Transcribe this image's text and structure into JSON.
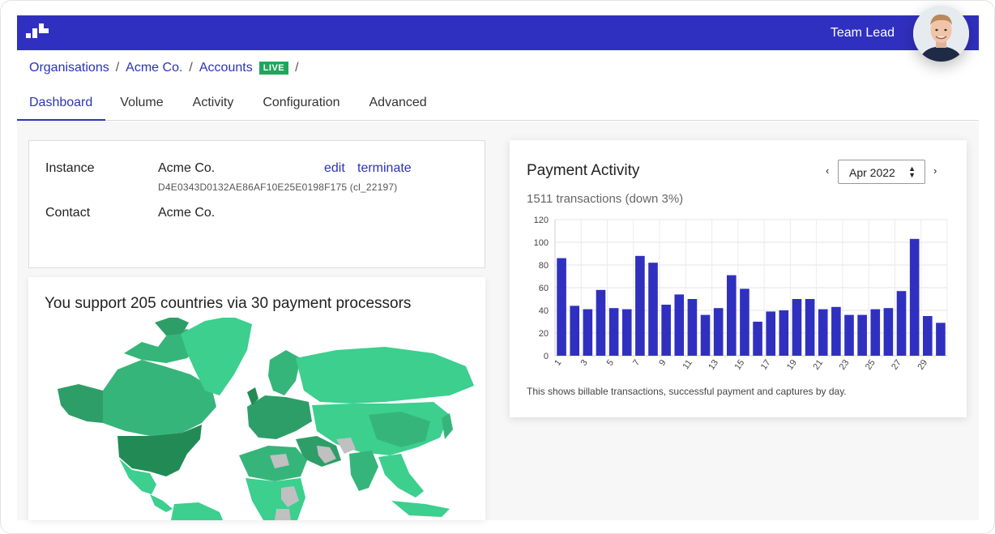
{
  "header": {
    "user_label": "Team Lead",
    "brand_color": "#3030c0"
  },
  "breadcrumb": {
    "items": [
      "Organisations",
      "Acme Co.",
      "Accounts"
    ],
    "separator": "/",
    "live_badge": "LIVE"
  },
  "tabs": [
    {
      "label": "Dashboard",
      "active": true
    },
    {
      "label": "Volume",
      "active": false
    },
    {
      "label": "Activity",
      "active": false
    },
    {
      "label": "Configuration",
      "active": false
    },
    {
      "label": "Advanced",
      "active": false
    }
  ],
  "instance_card": {
    "instance_label": "Instance",
    "instance_value": "Acme Co.",
    "instance_id": "D4E0343D0132AE86AF10E25E0198F175 (cl_22197)",
    "edit_label": "edit",
    "terminate_label": "terminate",
    "contact_label": "Contact",
    "contact_value": "Acme Co."
  },
  "map_card": {
    "title": "You support 205 countries via 30 payment processors"
  },
  "payment_card": {
    "title": "Payment Activity",
    "subtitle": "1511 transactions (down 3%)",
    "month": "Apr 2022",
    "prev_icon": "chevron-left-icon",
    "next_icon": "chevron-right-icon",
    "prev_glyph": "‹",
    "next_glyph": "›",
    "note": "This shows billable transactions, successful payment and captures by day."
  },
  "chart_data": {
    "type": "bar",
    "categories": [
      "1",
      "2",
      "3",
      "4",
      "5",
      "6",
      "7",
      "8",
      "9",
      "10",
      "11",
      "12",
      "13",
      "14",
      "15",
      "16",
      "17",
      "18",
      "19",
      "20",
      "21",
      "22",
      "23",
      "24",
      "25",
      "26",
      "27",
      "28",
      "29",
      "30"
    ],
    "x_tick_labels": [
      "1",
      "3",
      "5",
      "7",
      "9",
      "11",
      "13",
      "15",
      "17",
      "19",
      "21",
      "23",
      "25",
      "27",
      "29"
    ],
    "values": [
      86,
      44,
      41,
      58,
      42,
      41,
      88,
      82,
      45,
      54,
      50,
      36,
      42,
      71,
      59,
      30,
      39,
      40,
      50,
      50,
      41,
      43,
      36,
      36,
      41,
      42,
      57,
      103,
      35,
      29
    ],
    "ylim": [
      0,
      120
    ],
    "y_ticks": [
      0,
      20,
      40,
      60,
      80,
      100,
      120
    ],
    "grid": true,
    "bar_color": "#3030c0"
  }
}
